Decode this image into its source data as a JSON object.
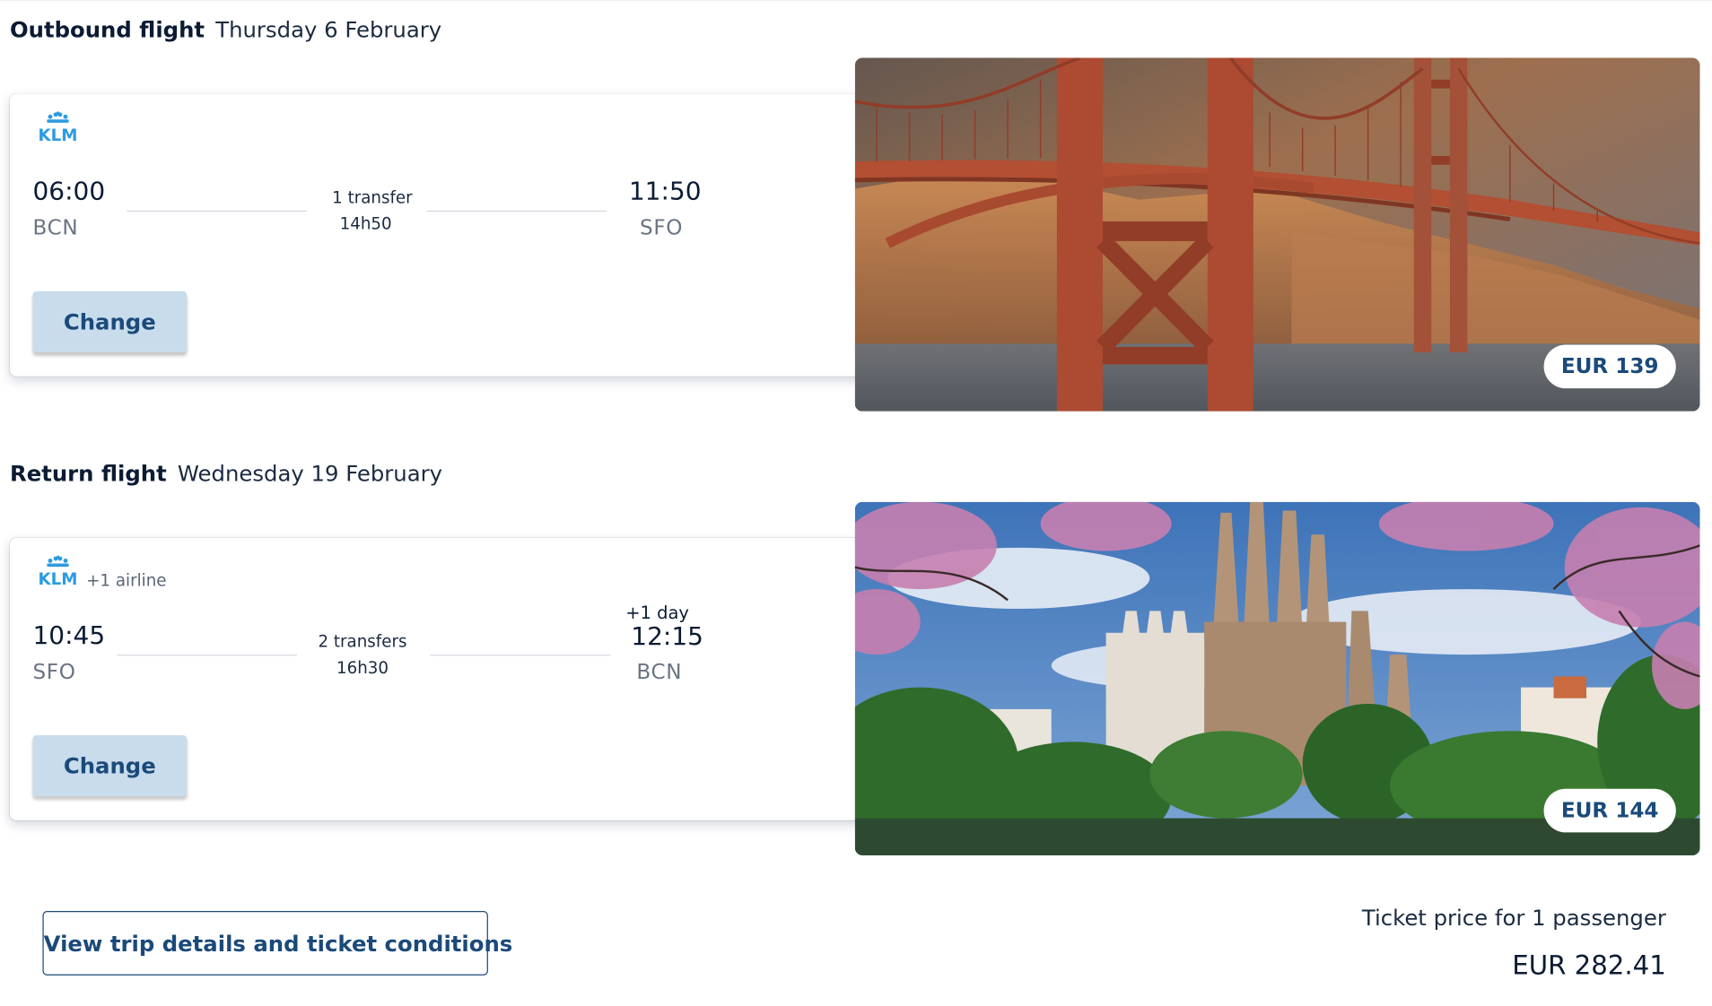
{
  "outbound": {
    "heading": "Outbound flight",
    "date": "Thursday 6 February",
    "airline_logo": "KLM",
    "departure_time": "06:00",
    "departure_airport": "BCN",
    "arrival_time": "11:50",
    "arrival_airport": "SFO",
    "transfers": "1 transfer",
    "duration": "14h50",
    "change_label": "Change",
    "image": "golden-gate-bridge-photo",
    "price": "EUR 139"
  },
  "return": {
    "heading": "Return flight",
    "date": "Wednesday 19 February",
    "airline_logo": "KLM",
    "extra_airline": "+1 airline",
    "departure_time": "10:45",
    "departure_airport": "SFO",
    "arrival_day_offset": "+1 day",
    "arrival_time": "12:15",
    "arrival_airport": "BCN",
    "transfers": "2 transfers",
    "duration": "16h30",
    "change_label": "Change",
    "image": "sagrada-familia-photo",
    "price": "EUR 144"
  },
  "footer": {
    "details_label": "View trip details and ticket conditions",
    "ticket_price_label": "Ticket price for 1 passenger",
    "ticket_price_total": "EUR 282.41"
  },
  "colors": {
    "brand_blue": "#1a4a7a",
    "button_bg": "#c8dcec",
    "klm_blue": "#2d9be0",
    "text_dark": "#0b1b33"
  }
}
